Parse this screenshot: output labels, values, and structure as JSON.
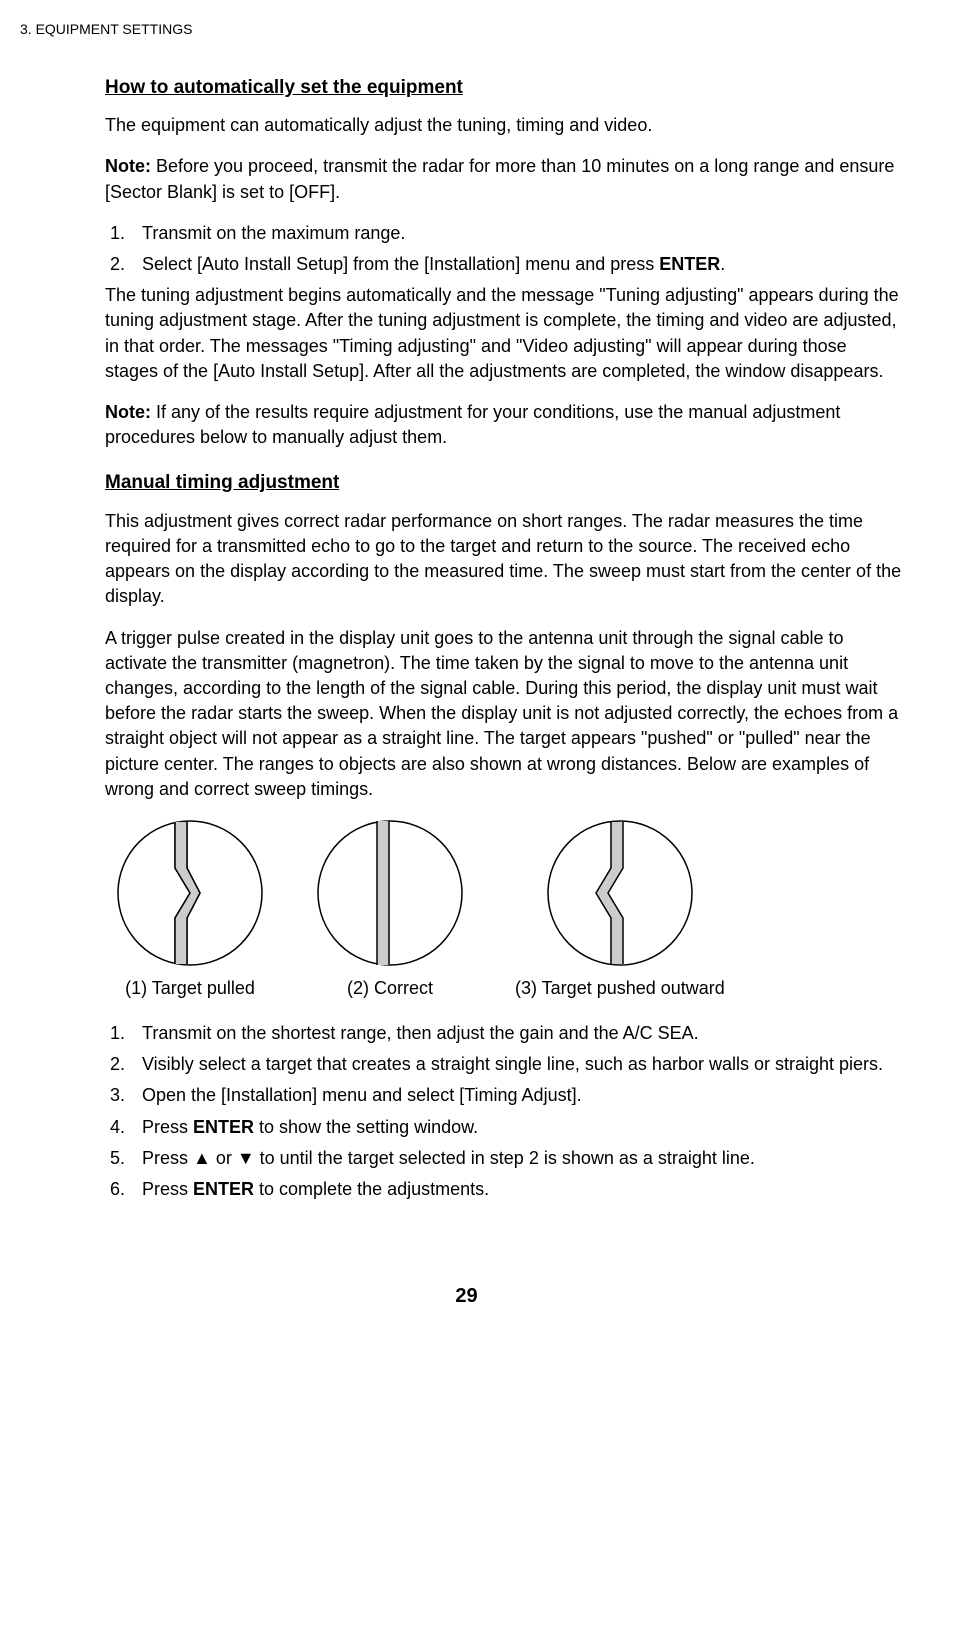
{
  "header": "3.  EQUIPMENT SETTINGS",
  "sec1": {
    "title": "How to automatically set the equipment",
    "p1": "The equipment can automatically adjust the tuning, timing and video.",
    "note1label": "Note:",
    "note1": " Before you proceed, transmit the radar for more than 10 minutes on a long range and ensure [Sector Blank] is set to [OFF].",
    "list": [
      "Transmit on the maximum range.",
      "Select [Auto Install Setup] from the [Installation] menu and press "
    ],
    "enter": "ENTER",
    "period": ".",
    "p2": "The tuning adjustment begins automatically and the message \"Tuning adjusting\" appears during the tuning adjustment stage. After the tuning adjustment is complete, the timing and video are adjusted, in that order. The messages \"Timing adjusting\" and \"Video adjusting\" will appear during those stages of the [Auto Install Setup]. After all the adjustments are completed, the window disappears.",
    "note2label": "Note:",
    "note2": " If any of the results require adjustment for your conditions, use the manual adjustment procedures below to manually adjust them."
  },
  "sec2": {
    "title": "Manual timing adjustment",
    "p1": "This adjustment gives correct radar performance on short ranges. The radar measures the time required for a transmitted echo to go to the target and return to the source. The received echo appears on the display according to the measured time. The sweep must start from the center of the display.",
    "p2": "A trigger pulse created in the display unit goes to the antenna unit through the signal cable to activate the transmitter (magnetron). The time taken by the signal to move to the antenna unit changes, according to the length of the signal cable. During this period, the display unit must wait before the radar starts the sweep. When the display unit is not adjusted correctly, the echoes from a straight object will not appear as a straight line. The target appears \"pushed\" or \"pulled\" near the picture center. The ranges to objects are also shown at wrong distances. Below are examples of wrong and correct sweep timings.",
    "cap1": "(1) Target pulled",
    "cap2": "(2) Correct",
    "cap3": "(3) Target pushed outward",
    "list": [
      "Transmit on the shortest range, then adjust the gain and the A/C SEA.",
      "Visibly select a target that creates a straight single line, such as harbor walls or straight piers.",
      "Open the [Installation] menu and select [Timing Adjust].",
      "Press ",
      "Press ▲ or ▼ to until the target selected in step 2 is shown as a straight line.",
      "Press "
    ],
    "li4suffix": " to show the setting window.",
    "li6suffix": " to complete the adjustments."
  },
  "pageNum": "29"
}
